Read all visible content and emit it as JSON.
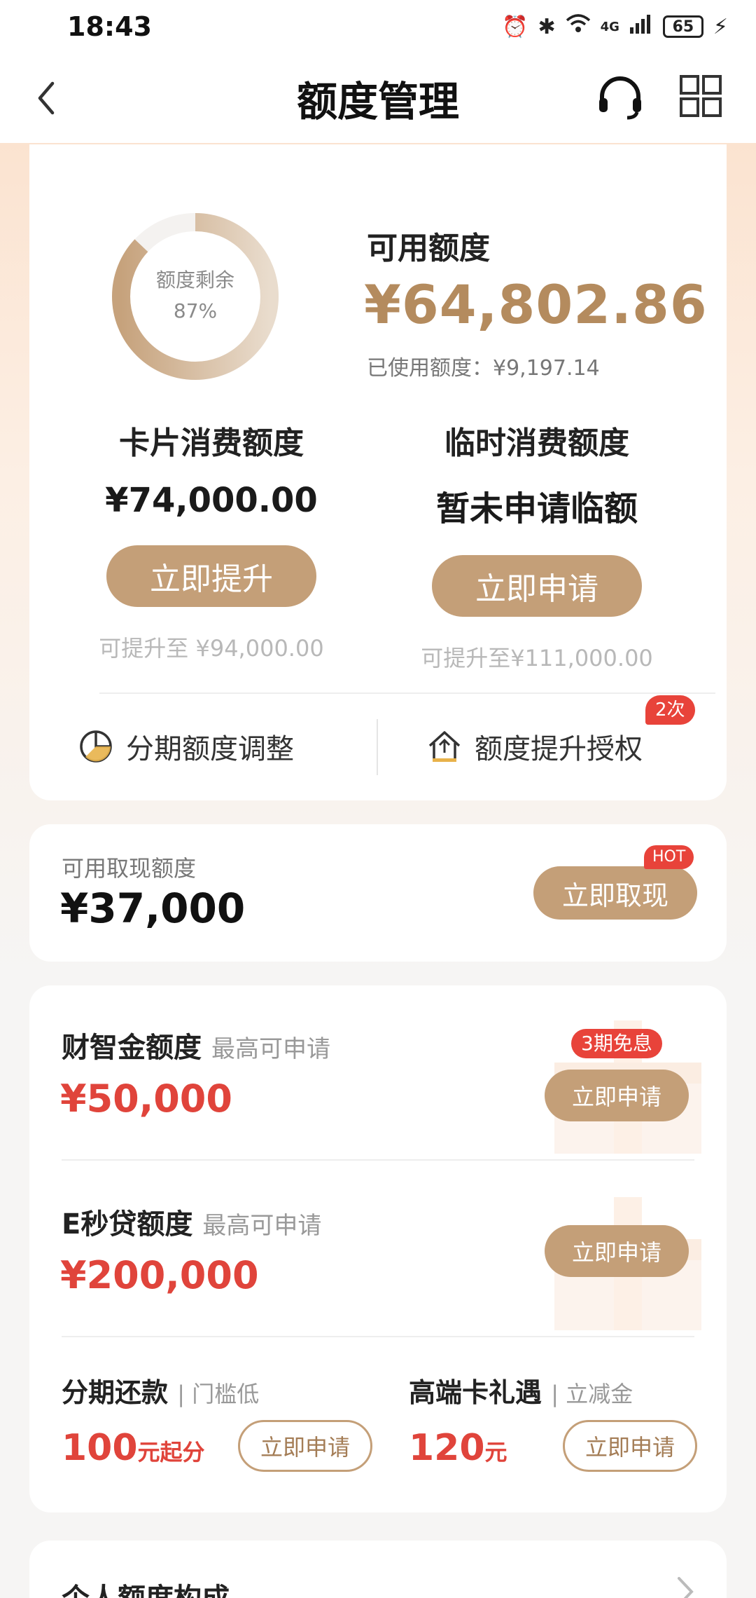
{
  "status_bar": {
    "time": "18:43",
    "network": "4G",
    "battery": "65"
  },
  "nav": {
    "title": "额度管理",
    "icons": [
      "back-arrow-icon",
      "customer-service-icon",
      "grid-menu-icon"
    ]
  },
  "credit": {
    "remaining_label": "额度剩余",
    "remaining_percent_text": "87%",
    "remaining_fraction": 0.87,
    "available_label": "可用额度",
    "available_amount": "¥64,802.86",
    "used_line": "已使用额度：¥9,197.14",
    "card_limit_label": "卡片消费额度",
    "card_limit_value": "¥74,000.00",
    "raise_button": "立即提升",
    "raise_hint": "可提升至 ¥94,000.00",
    "temp_limit_label": "临时消费额度",
    "temp_limit_value": "暂未申请临额",
    "temp_button": "立即申请",
    "temp_hint": "可提升至¥111,000.00",
    "installment_adjust": "分期额度调整",
    "raise_authorize": "额度提升授权",
    "authorize_badge": "2次"
  },
  "cash": {
    "label": "可用取现额度",
    "amount": "¥37,000",
    "button": "立即取现",
    "badge": "HOT"
  },
  "products": {
    "caizhijin": {
      "title": "财智金额度",
      "sub": "最高可申请",
      "amount": "¥50,000",
      "button": "立即申请",
      "badge": "3期免息"
    },
    "emiaodai": {
      "title": "E秒贷额度",
      "sub": "最高可申请",
      "amount": "¥200,000",
      "button": "立即申请"
    },
    "installment": {
      "title": "分期还款",
      "sub": "门槛低",
      "amount": "100",
      "unit": "元起分",
      "button": "立即申请"
    },
    "premium": {
      "title": "高端卡礼遇",
      "sub": "立减金",
      "amount": "120",
      "unit": "元",
      "button": "立即申请"
    }
  },
  "bottom": {
    "title": "个人额度构成"
  },
  "colors": {
    "accent": "#c49f78",
    "amount_gold": "#b48b5e",
    "red": "#e0443b"
  }
}
